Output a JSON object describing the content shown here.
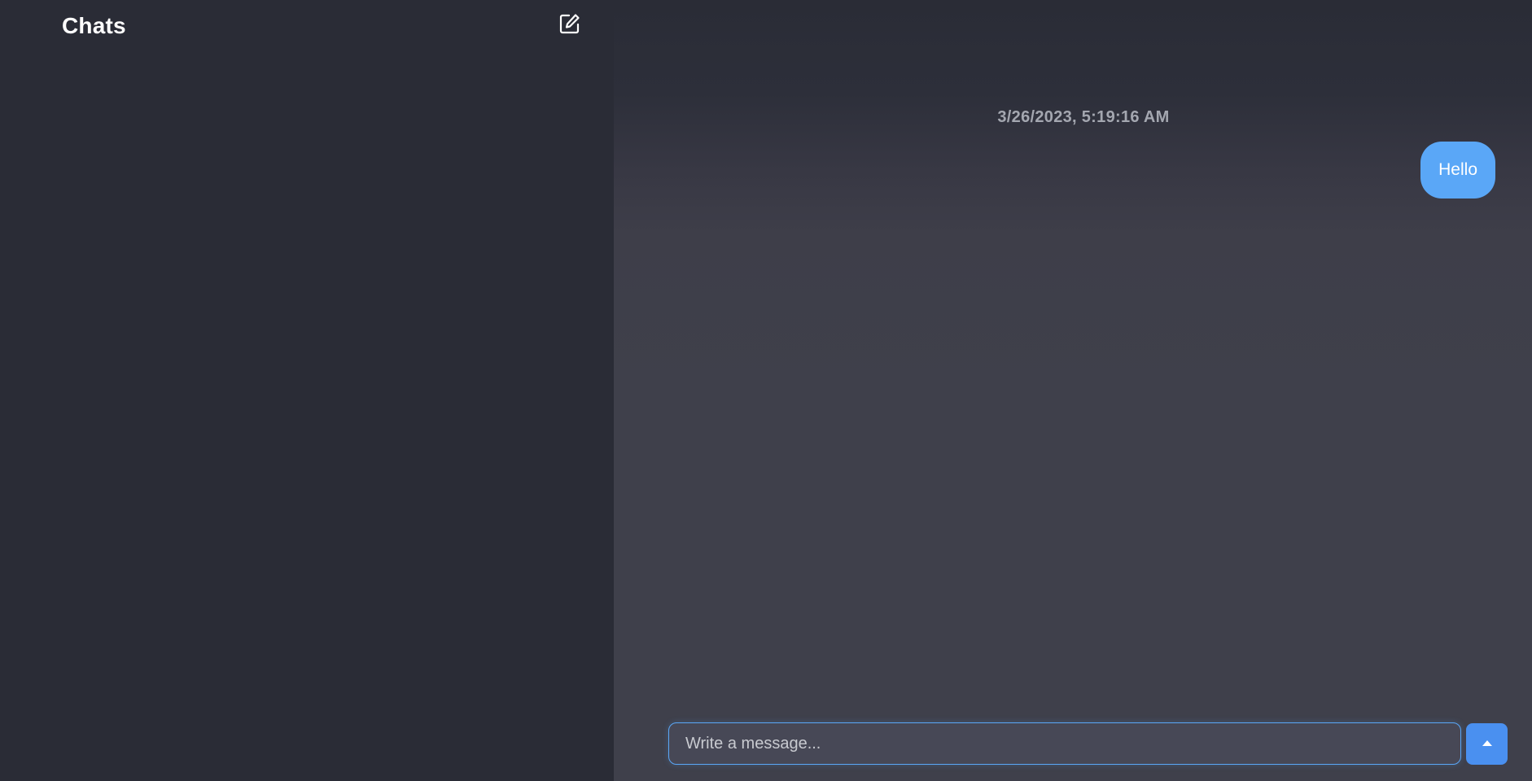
{
  "sidebar": {
    "title": "Chats",
    "compose_icon": "compose-icon"
  },
  "conversation": {
    "timestamp": "3/26/2023, 5:19:16 AM",
    "messages": [
      {
        "text": "Hello",
        "sender": "self"
      }
    ]
  },
  "composer": {
    "placeholder": "Write a message...",
    "value": "",
    "send_icon": "caret-up-icon"
  },
  "colors": {
    "accent": "#5aa7f7",
    "send_button": "#4a90f0",
    "sidebar_bg": "#2a2c36",
    "main_bg": "#3f404b",
    "input_bg": "#474856",
    "timestamp_text": "#a4a7b0"
  }
}
